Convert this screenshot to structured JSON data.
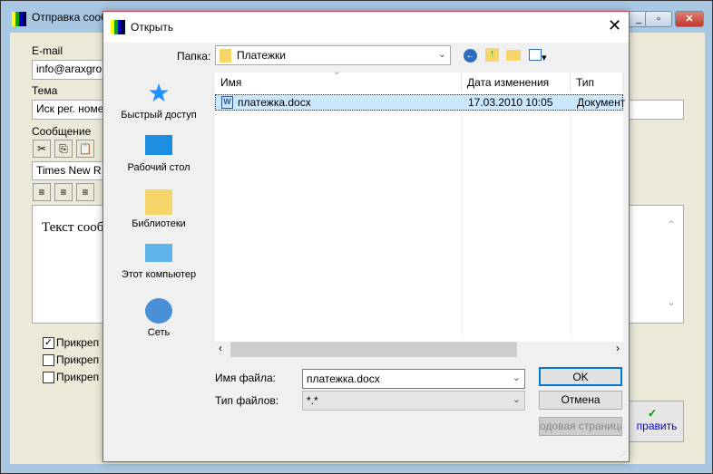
{
  "background_window": {
    "title": "Отправка сооб",
    "email_label": "E-mail",
    "email_value": "info@araxgro",
    "subject_label": "Тема",
    "subject_value": "Иск рег. номе",
    "message_label": "Сообщение",
    "font_value": "Times New R",
    "message_text": "Текст сооб",
    "checkboxes": [
      {
        "label": "Прикреп",
        "checked": true
      },
      {
        "label": "Прикреп",
        "checked": false
      },
      {
        "label": "Прикреп",
        "checked": false
      }
    ],
    "send_label": "править"
  },
  "dialog": {
    "title": "Открыть",
    "folder_label": "Папка:",
    "folder_value": "Платежки",
    "sidebar": [
      {
        "label": "Быстрый доступ"
      },
      {
        "label": "Рабочий стол"
      },
      {
        "label": "Библиотеки"
      },
      {
        "label": "Этот компьютер"
      },
      {
        "label": "Сеть"
      }
    ],
    "columns": [
      "Имя",
      "Дата изменения",
      "Тип"
    ],
    "files": [
      {
        "name": "платежка.docx",
        "date": "17.03.2010 10:05",
        "type": "Документ"
      }
    ],
    "filename_label": "Имя файла:",
    "filename_value": "платежка.docx",
    "filetype_label": "Тип файлов:",
    "filetype_value": "*.*",
    "ok_label": "OK",
    "cancel_label": "Отмена",
    "codepage_label": "одовая страница."
  }
}
